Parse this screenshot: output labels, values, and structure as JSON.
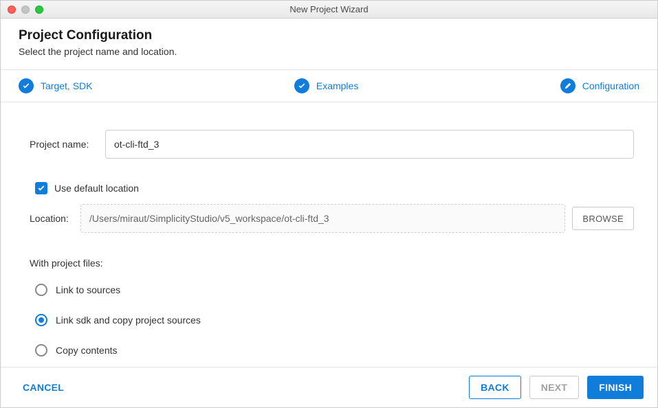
{
  "window": {
    "title": "New Project Wizard"
  },
  "header": {
    "title": "Project Configuration",
    "subtitle": "Select the project name and location."
  },
  "steps": {
    "target": "Target, SDK",
    "examples": "Examples",
    "configuration": "Configuration"
  },
  "form": {
    "project_name_label": "Project name:",
    "project_name_value": "ot-cli-ftd_3",
    "use_default_location_label": "Use default location",
    "use_default_location_checked": true,
    "location_label": "Location:",
    "location_value": "/Users/miraut/SimplicityStudio/v5_workspace/ot-cli-ftd_3",
    "browse_label": "BROWSE",
    "with_project_files_label": "With project files:",
    "radios": {
      "link_sources": "Link to sources",
      "link_sdk_copy": "Link sdk and copy project sources",
      "copy_contents": "Copy contents",
      "selected": "link_sdk_copy"
    }
  },
  "footer": {
    "cancel": "CANCEL",
    "back": "BACK",
    "next": "NEXT",
    "finish": "FINISH"
  }
}
